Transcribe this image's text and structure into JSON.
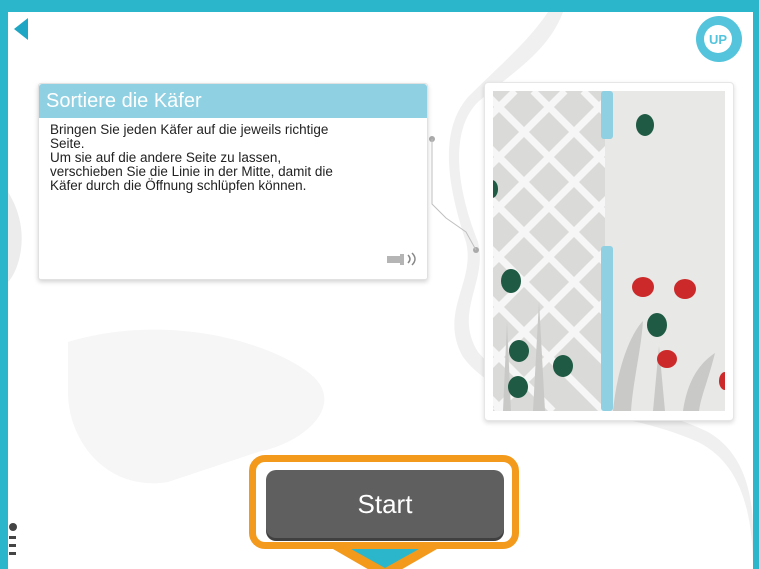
{
  "back_button": {
    "icon": "back-arrow-icon"
  },
  "logo": {
    "text": "UP"
  },
  "card": {
    "title": "Sortiere die Käfer",
    "lines": [
      "Bringen Sie jeden Käfer auf die jeweils richtige",
      "Seite.",
      "Um sie auf die andere Seite zu lassen,",
      "verschieben Sie die Linie in der Mitte, damit die",
      "Käfer durch die Öffnung schlüpfen können."
    ],
    "audio_icon": "speaker-icon"
  },
  "start_button": {
    "label": "Start"
  },
  "colors": {
    "frame": "#2bb6cc",
    "accent_blue": "#8fd0e2",
    "highlight": "#f39a1c",
    "button": "#5f5f5f"
  }
}
